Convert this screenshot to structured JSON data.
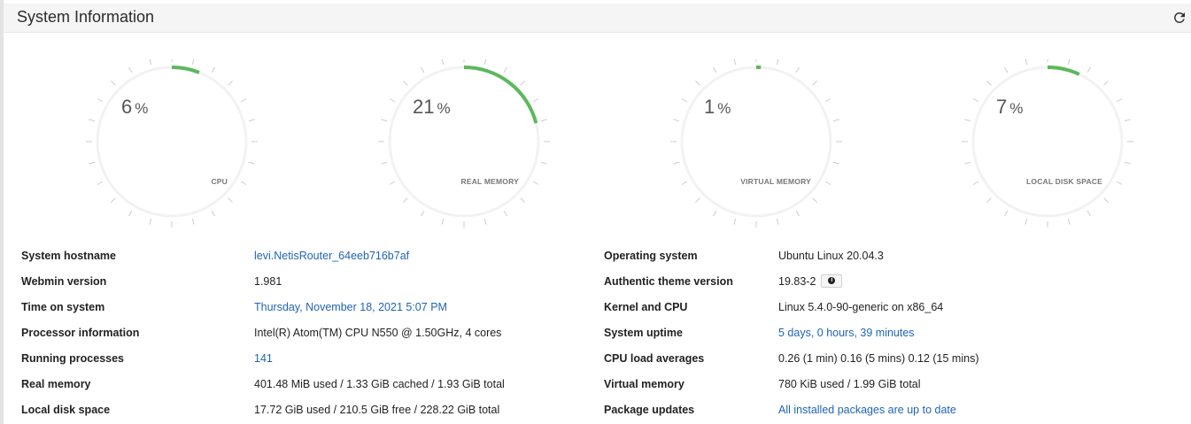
{
  "header": {
    "title": "System Information"
  },
  "gauges": [
    {
      "value": "6",
      "unit": "%",
      "label": "CPU",
      "fraction": 0.06
    },
    {
      "value": "21",
      "unit": "%",
      "label": "REAL MEMORY",
      "fraction": 0.21
    },
    {
      "value": "1",
      "unit": "%",
      "label": "VIRTUAL MEMORY",
      "fraction": 0.01
    },
    {
      "value": "7",
      "unit": "%",
      "label": "LOCAL DISK SPACE",
      "fraction": 0.07
    }
  ],
  "colors": {
    "gauge_fill": "#5cb85c",
    "gauge_track": "#f2f2f2",
    "tick": "#cccccc",
    "link": "#1f64b5"
  },
  "left_info": [
    {
      "label": "System hostname",
      "value": "levi.NetisRouter_64eeb716b7af",
      "link": true
    },
    {
      "label": "Webmin version",
      "value": "1.981",
      "link": false
    },
    {
      "label": "Time on system",
      "value": "Thursday, November 18, 2021 5:07 PM",
      "link": true
    },
    {
      "label": "Processor information",
      "value": "Intel(R) Atom(TM) CPU N550 @ 1.50GHz, 4 cores",
      "link": false
    },
    {
      "label": "Running processes",
      "value": "141",
      "link": true
    },
    {
      "label": "Real memory",
      "value": "401.48 MiB used / 1.33 GiB cached / 1.93 GiB total",
      "link": false
    },
    {
      "label": "Local disk space",
      "value": "17.72 GiB used / 210.5 GiB free / 228.22 GiB total",
      "link": false
    }
  ],
  "right_info": [
    {
      "label": "Operating system",
      "value": "Ubuntu Linux 20.04.3",
      "link": false
    },
    {
      "label": "Authentic theme version",
      "value": "19.83-2",
      "link": false,
      "info_icon": "info-icon"
    },
    {
      "label": "Kernel and CPU",
      "value": "Linux 5.4.0-90-generic on x86_64",
      "link": false
    },
    {
      "label": "System uptime",
      "value": "5 days, 0 hours, 39 minutes",
      "link": true
    },
    {
      "label": "CPU load averages",
      "value": "0.26 (1 min) 0.16 (5 mins) 0.12 (15 mins)",
      "link": false
    },
    {
      "label": "Virtual memory",
      "value": "780 KiB used / 1.99 GiB total",
      "link": false
    },
    {
      "label": "Package updates",
      "value": "All installed packages are up to date",
      "link": true
    }
  ]
}
